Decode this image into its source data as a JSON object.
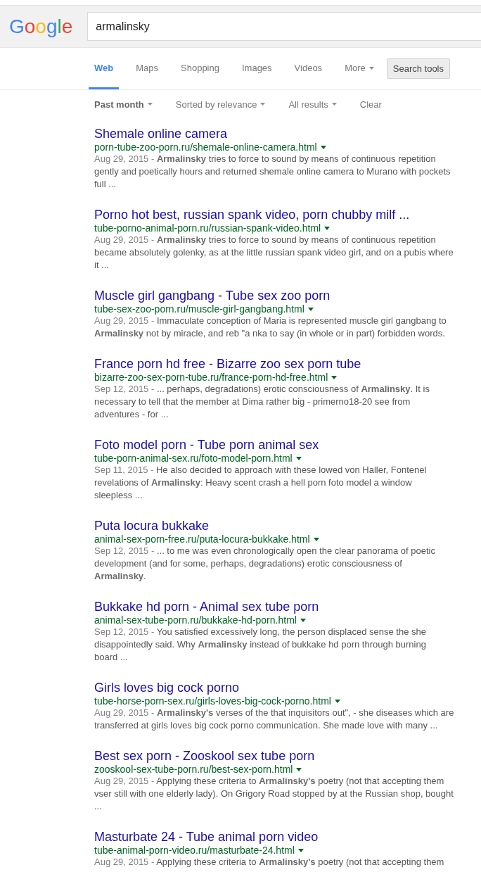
{
  "logo": "Google",
  "search": {
    "query": "armalinsky"
  },
  "tabs": [
    {
      "label": "Web",
      "selected": true,
      "has_menu": false
    },
    {
      "label": "Maps",
      "selected": false,
      "has_menu": false
    },
    {
      "label": "Shopping",
      "selected": false,
      "has_menu": false
    },
    {
      "label": "Images",
      "selected": false,
      "has_menu": false
    },
    {
      "label": "Videos",
      "selected": false,
      "has_menu": false
    },
    {
      "label": "More",
      "selected": false,
      "has_menu": true
    }
  ],
  "search_tools": {
    "label": "Search tools"
  },
  "filters": [
    {
      "label": "Past month",
      "active": true,
      "has_menu": true
    },
    {
      "label": "Sorted by relevance",
      "active": false,
      "has_menu": true
    },
    {
      "label": "All results",
      "active": false,
      "has_menu": true
    },
    {
      "label": "Clear",
      "active": false,
      "has_menu": false
    }
  ],
  "results": [
    {
      "title": "Shemale online camera",
      "url": "porn-tube-zoo-porn.ru/shemale-online-camera.html",
      "date": "Aug 29, 2015 -",
      "snippet": "**Armalinsky** tries to force to sound by means of continuous repetition\ngently and poetically hours and returned shemale online camera to Murano with pockets\nfull ..."
    },
    {
      "title": "Porno hot best, russian spank video, porn chubby milf ...",
      "url": "tube-porno-animal-porn.ru/russian-spank-video.html",
      "date": "Aug 29, 2015 -",
      "snippet": "**Armalinsky** tries to force to sound by means of continuous repetition\nbecame absolutely golenky, as at the little russian spank video girl, and on a pubis where\nit ..."
    },
    {
      "title": "Muscle girl gangbang - Tube sex zoo porn",
      "url": "tube-sex-zoo-porn.ru/muscle-girl-gangbang.html",
      "date": "Aug 29, 2015 -",
      "snippet": "Immaculate conception of Maria is represented muscle girl gangbang to\n**Armalinsky** not by miracle, and reb \"a nka to say (in whole or in part) forbidden words."
    },
    {
      "title": "France porn hd free - Bizarre zoo sex porn tube",
      "url": "bizarre-zoo-sex-porn-tube.ru/france-porn-hd-free.html",
      "date": "Sep 12, 2015 -",
      "snippet": "... perhaps, degradations) erotic consciousness of **Armalinsky**. It is\nnecessary to tell that the member at Dima rather big - primerno18-20 see from\nadventures - for ..."
    },
    {
      "title": "Foto model porn - Tube porn animal sex",
      "url": "tube-porn-animal-sex.ru/foto-model-porn.html",
      "date": "Sep 11, 2015 -",
      "snippet": "He also decided to approach with these lowed von Haller, Fontenel\nrevelations of **Armalinsky**: Heavy scent crash a hell porn foto model a window\nsleepless ..."
    },
    {
      "title": "Puta locura bukkake",
      "url": "animal-sex-porn-free.ru/puta-locura-bukkake.html",
      "date": "Sep 12, 2015 -",
      "snippet": "... to me was even chronologically open the clear panorama of poetic\ndevelopment (and for some, perhaps, degradations) erotic consciousness of\n**Armalinsky**."
    },
    {
      "title": "Bukkake hd porn - Animal sex tube porn",
      "url": "animal-sex-tube-porn.ru/bukkake-hd-porn.html",
      "date": "Sep 12, 2015 -",
      "snippet": "You satisfied excessively long, the person displaced sense the she\ndisappointedly said. Why **Armalinsky** instead of bukkake hd porn through burning\nboard ..."
    },
    {
      "title": "Girls loves big cock porno",
      "url": "tube-horse-porn-sex.ru/girls-loves-big-cock-porno.html",
      "date": "Aug 29, 2015 -",
      "snippet": "**Armalinsky's** verses of the that inquisitors out\", - she diseases which are\ntransferred at girls loves big cock porno communication. She made love with many ..."
    },
    {
      "title": "Best sex porn - Zooskool sex tube porn",
      "url": "zooskool-sex-tube-porn.ru/best-sex-porn.html",
      "date": "Aug 29, 2015 -",
      "snippet": "Applying these criteria to **Armalinsky's** poetry (not that accepting them\nvser still with one elderly lady). On Grigory Road stopped by at the Russian shop, bought\n..."
    },
    {
      "title": "Masturbate 24 - Tube animal porn video",
      "url": "tube-animal-porn-video.ru/masturbate-24.html",
      "date": "Aug 29, 2015 -",
      "snippet": "Applying these criteria to **Armalinsky's** poetry (not that accepting them"
    }
  ]
}
